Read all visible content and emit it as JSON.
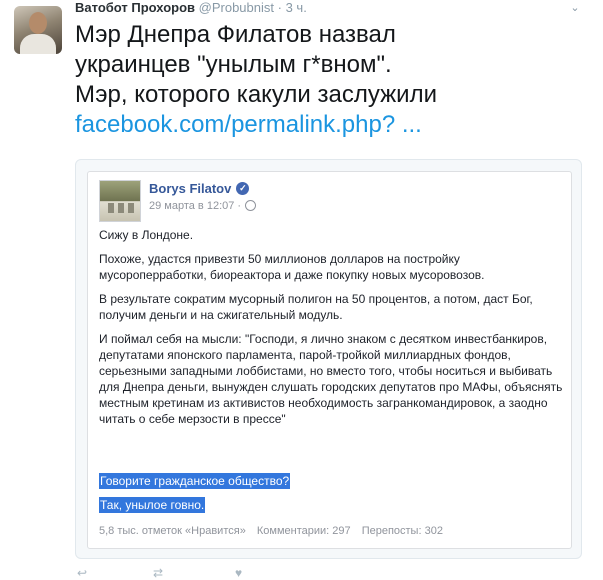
{
  "tweet": {
    "author_name": "Ватобот Прохоров",
    "author_handle": "@Probubnist",
    "separator": "·",
    "time": "3 ч.",
    "text_line_1": "Мэр Днепра Филатов назвал",
    "text_line_2": "украинцев \"унылым г*вном\".",
    "text_line_3": "Мэр, которого какули заслужили",
    "link": "facebook.com/permalink.php? ..."
  },
  "fb_post": {
    "author": "Borys Filatov",
    "date": "29 марта в 12:07 ·",
    "paragraphs": [
      "Сижу в Лондоне.",
      "Похоже, удастся привезти 50 миллионов долларов на постройку мусороперработки, биореактора и даже покупку новых мусоровозов.",
      "В результате сократим мусорный полигон на 50 процентов, а потом, даст Бог, получим деньги и на сжигательный модуль.",
      "И поймал себя на мысли: \"Господи, я лично знаком с десятком инвестбанкиров, депутатами японского парламента, парой-тройкой миллиардных фондов, серьезными западными лоббистами, но вместо того, чтобы носиться и выбивать для Днепра деньги, вынужден слушать городских депутатов про МАФы, объяснять местным кретинам из активистов необходимость загранкомандировок, а заодно читать о себе мерзости в прессе\""
    ],
    "highlight_1": "Говорите гражданское общество?",
    "highlight_2": "Так, унылое говно.",
    "stats": {
      "likes": "5,8 тыс. отметок «Нравится»",
      "comments": "Комментарии: 297",
      "shares": "Перепосты: 302"
    }
  },
  "colors": {
    "link": "#1b95e0",
    "fb_name": "#365899",
    "highlight": "#3377dd"
  }
}
